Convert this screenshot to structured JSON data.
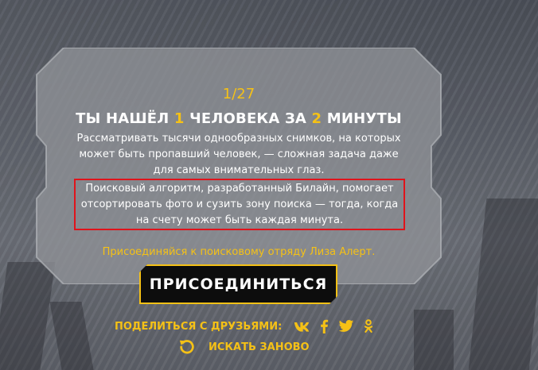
{
  "result": {
    "counter": "1/27",
    "title_prefix": "ТЫ НАШЁЛ",
    "title_num1": "1",
    "title_middle": "ЧЕЛОВЕКА ЗА",
    "title_num2": "2",
    "title_suffix": "МИНУТЫ"
  },
  "description": {
    "line1": "Рассматривать тысячи однообразных снимков, на которых",
    "line2": "может быть пропавший человек, — сложная задача даже",
    "line3": "для самых внимательных глаз."
  },
  "algorithm": {
    "line1": "Поисковый алгоритм, разработанный Билайн, помогает",
    "line2": "отсортировать фото и сузить зону поиска — тогда, когда",
    "line3": "на счету может быть каждая минута."
  },
  "join": {
    "text": "Присоединяйся к поисковому отряду Лиза Алерт.",
    "button_label": "ПРИСОЕДИНИТЬСЯ"
  },
  "share": {
    "label": "ПОДЕЛИТЬСЯ С ДРУЗЬЯМИ:",
    "networks": [
      "vk-icon",
      "facebook-icon",
      "twitter-icon",
      "odnoklassniki-icon"
    ]
  },
  "restart": {
    "label": "ИСКАТЬ ЗАНОВО",
    "icon": "refresh-icon"
  },
  "colors": {
    "accent": "#f5c116",
    "highlight_border": "#e0131b",
    "button_bg": "#0d0d0d",
    "panel_fill": "#8f9297"
  }
}
